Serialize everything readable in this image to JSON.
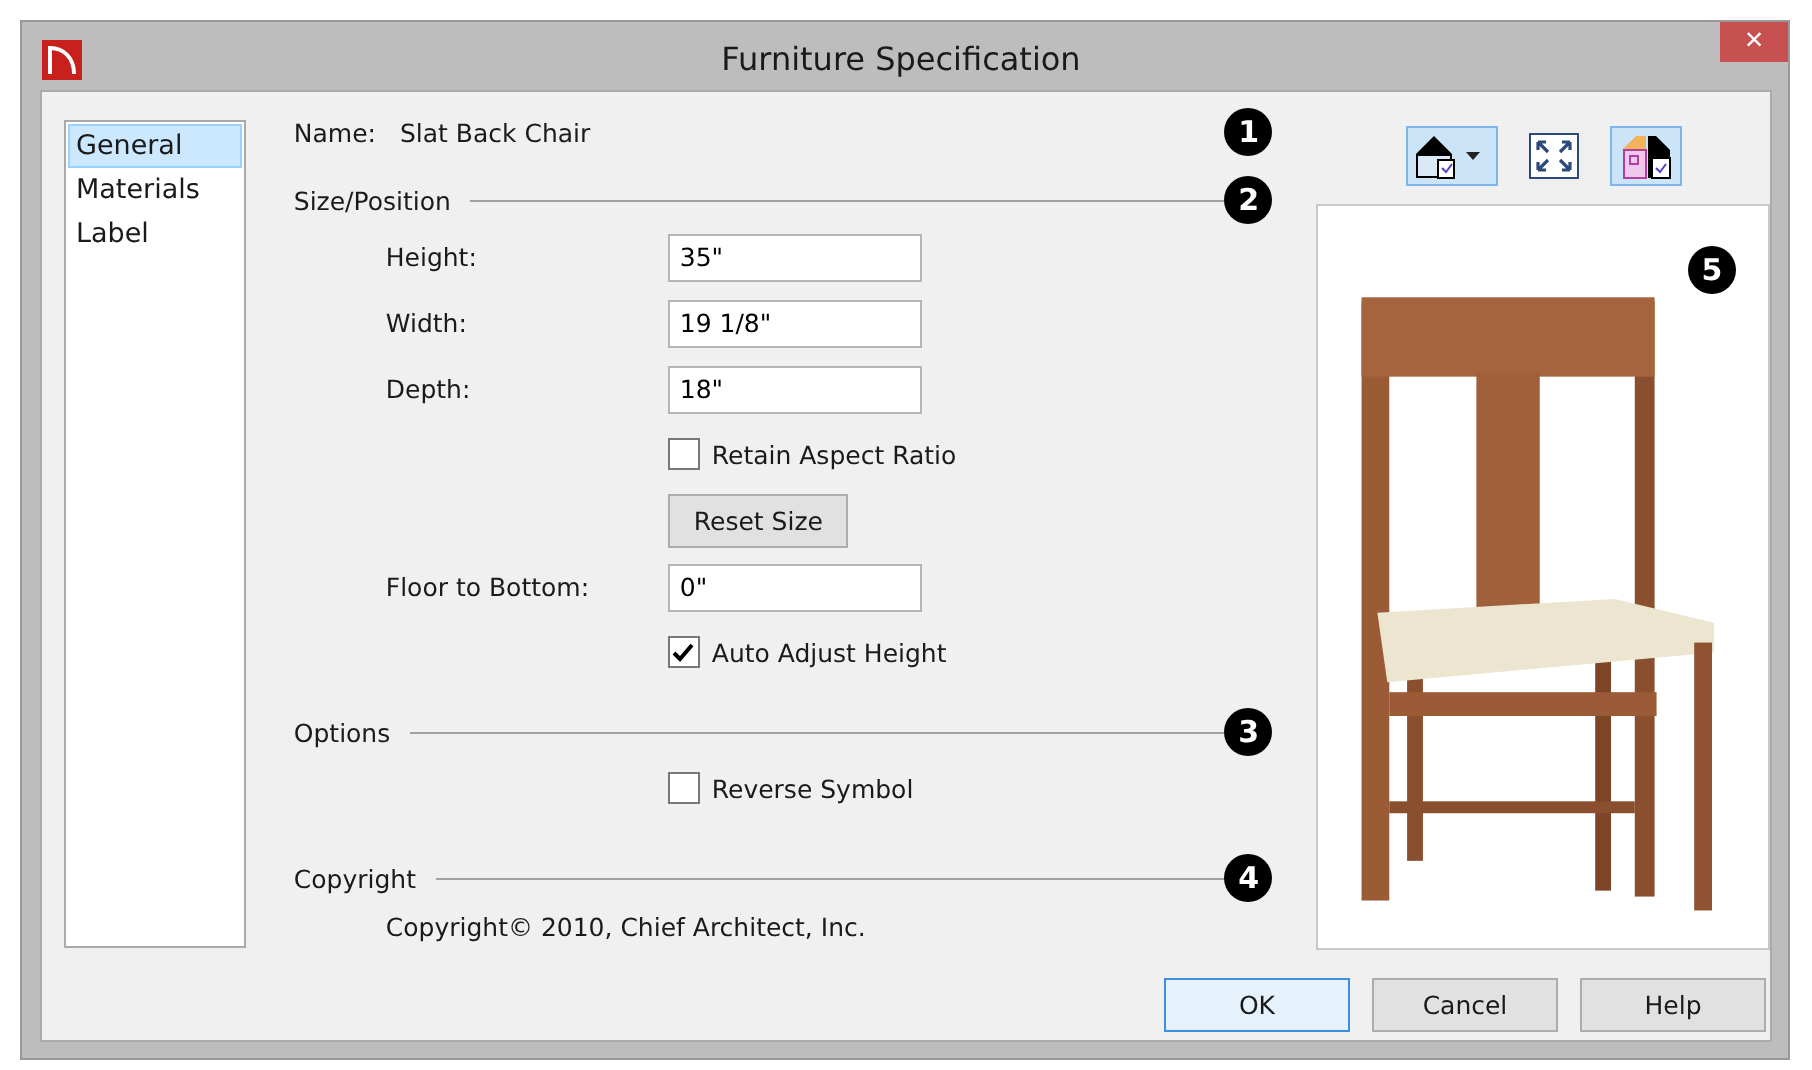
{
  "window": {
    "title": "Furniture Specification",
    "close": "×"
  },
  "sidebar": {
    "items": [
      {
        "label": "General",
        "selected": true
      },
      {
        "label": "Materials",
        "selected": false
      },
      {
        "label": "Label",
        "selected": false
      }
    ]
  },
  "name": {
    "label": "Name:",
    "value": "Slat Back Chair",
    "callout": "1"
  },
  "sections": [
    {
      "title": "Size/Position",
      "callout": "2",
      "rows": [
        {
          "kind": "field",
          "label": "Height:",
          "value": "35\""
        },
        {
          "kind": "field",
          "label": "Width:",
          "value": "19 1/8\""
        },
        {
          "kind": "field",
          "label": "Depth:",
          "value": "18\""
        },
        {
          "kind": "checkbox",
          "label": "Retain Aspect Ratio",
          "checked": false
        },
        {
          "kind": "button",
          "label": "Reset Size"
        },
        {
          "kind": "field",
          "label": "Floor to Bottom:",
          "value": "0\""
        },
        {
          "kind": "checkbox",
          "label": "Auto Adjust Height",
          "checked": true
        }
      ]
    },
    {
      "title": "Options",
      "callout": "3",
      "rows": [
        {
          "kind": "checkbox",
          "label": "Reverse Symbol",
          "checked": false
        }
      ]
    },
    {
      "title": "Copyright",
      "callout": "4",
      "rows": [
        {
          "kind": "text",
          "text": "Copyright© 2010, Chief Architect, Inc."
        }
      ]
    }
  ],
  "preview": {
    "callout": "5",
    "toolbar": [
      {
        "kind": "view",
        "selected": true
      },
      {
        "kind": "fit",
        "selected": false
      },
      {
        "kind": "house",
        "selected": true
      }
    ],
    "kind": "picture"
  },
  "buttons": [
    {
      "label": "OK",
      "default": true
    },
    {
      "label": "Cancel",
      "default": false
    },
    {
      "label": "Help",
      "default": false
    }
  ]
}
